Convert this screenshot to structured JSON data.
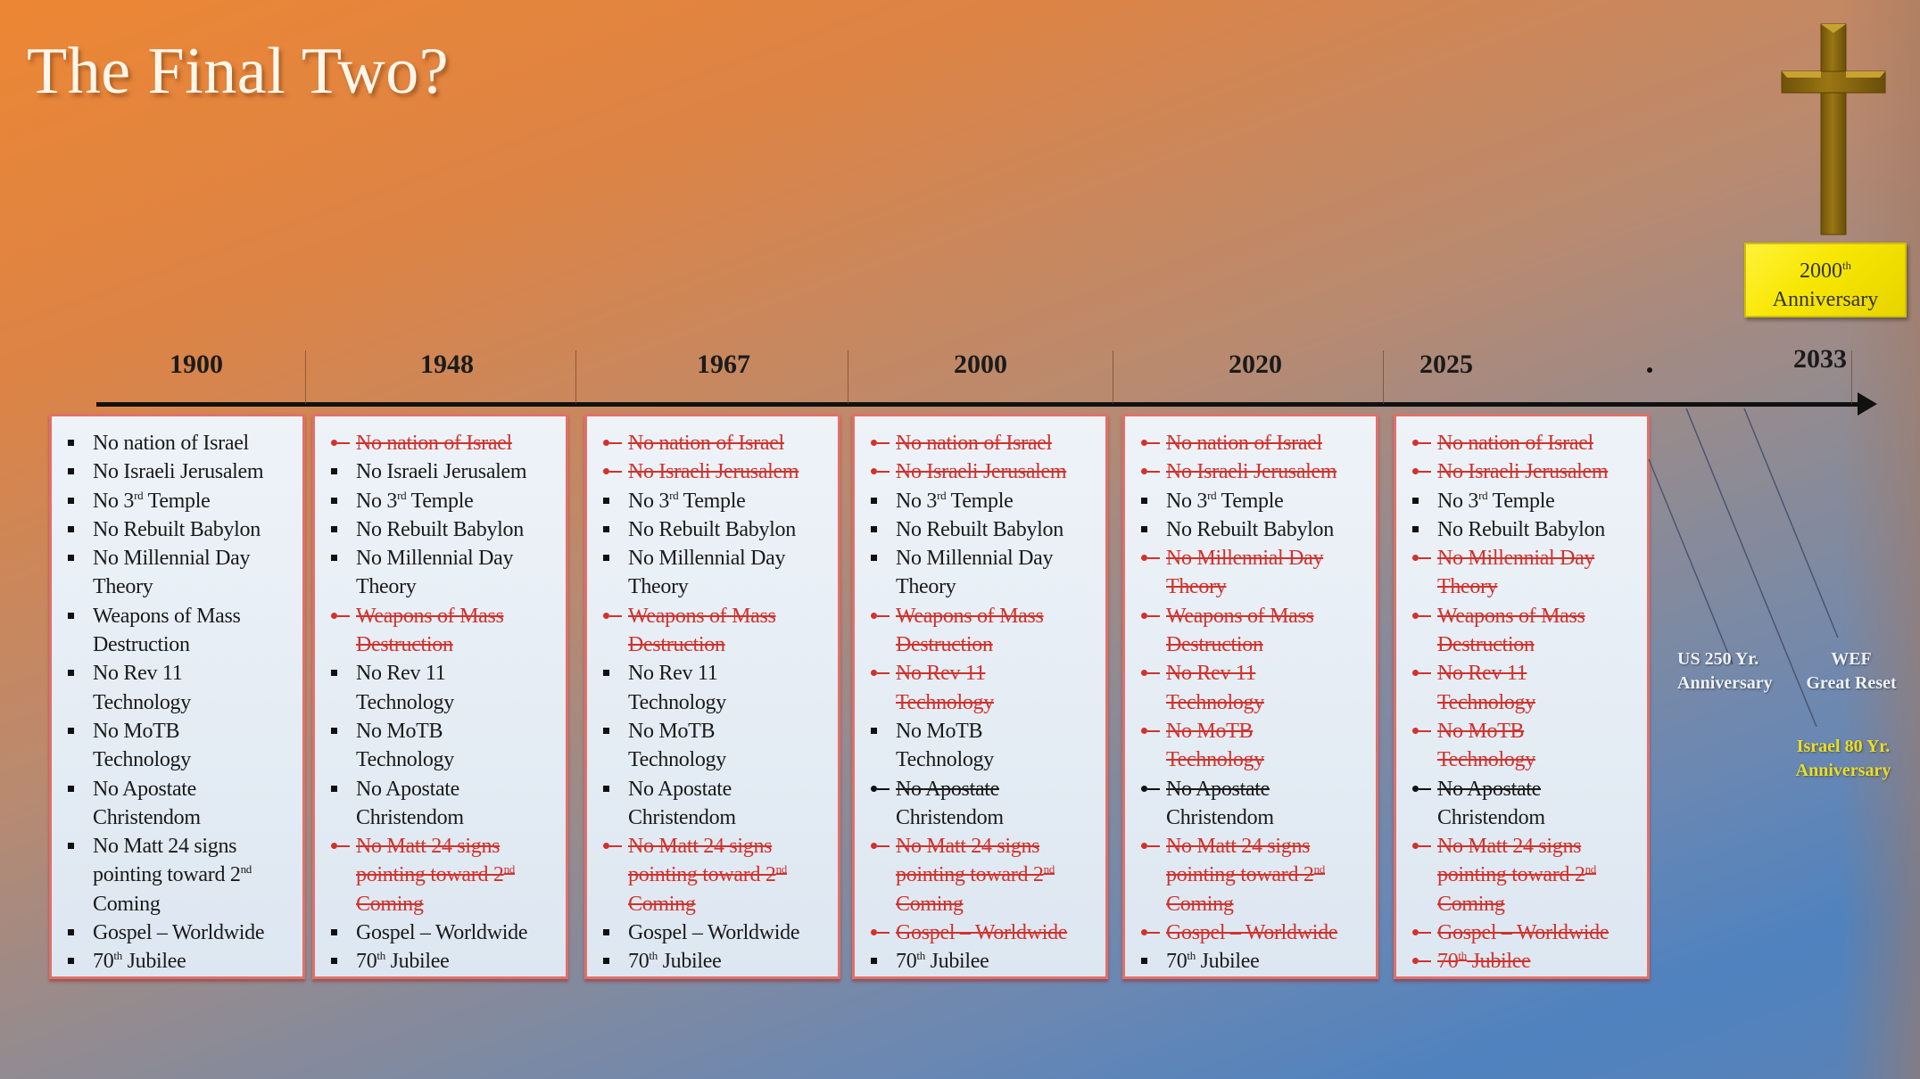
{
  "slide": {
    "title": "The Final Two?",
    "anniversary_badge": {
      "number": "2000",
      "suffix": "th",
      "label": "Anniversary"
    },
    "colors": {
      "struck_red": "#d0322d",
      "box_border": "#e0706a",
      "badge_yellow": "#f7e600",
      "gold_label": "#e9dd2c"
    }
  },
  "timeline": {
    "years": [
      "1900",
      "1948",
      "1967",
      "2000",
      "2020",
      "2025",
      "2033"
    ],
    "marker": "•",
    "events": [
      {
        "label_line1": "US 250 Yr.",
        "label_line2": "Anniversary",
        "style": "white"
      },
      {
        "label_line1": "WEF",
        "label_line2": "Great Reset",
        "style": "white"
      },
      {
        "label_line1": "Israel 80 Yr.",
        "label_line2": "Anniversary",
        "style": "gold"
      }
    ]
  },
  "items": [
    {
      "text": "No nation of Israel"
    },
    {
      "text": "No Israeli Jerusalem"
    },
    {
      "pre": "No 3",
      "sup": "rd",
      "post": " Temple"
    },
    {
      "text": "No Rebuilt Babylon"
    },
    {
      "line1": "No Millennial Day",
      "line2": "Theory"
    },
    {
      "line1": "Weapons of Mass",
      "line2": "Destruction"
    },
    {
      "line1": "No Rev 11",
      "line2": "Technology"
    },
    {
      "line1": "No MoTB",
      "line2": "Technology"
    },
    {
      "line1": "No Apostate",
      "line2": "Christendom"
    },
    {
      "line1": "No Matt 24 signs",
      "line2pre": "pointing toward 2",
      "line2sup": "nd",
      "line3": "Coming"
    },
    {
      "text": "Gospel – Worldwide"
    },
    {
      "pre": "70",
      "sup": "th",
      "post": " Jubilee"
    }
  ],
  "columns": [
    {
      "year": "1900",
      "status": [
        "none",
        "none",
        "none",
        "none",
        "none",
        "none",
        "none",
        "none",
        "none",
        "none",
        "none",
        "none"
      ]
    },
    {
      "year": "1948",
      "status": [
        "red",
        "none",
        "none",
        "none",
        "none",
        "red",
        "none",
        "none",
        "none",
        "red",
        "none",
        "none"
      ]
    },
    {
      "year": "1967",
      "status": [
        "red",
        "red",
        "none",
        "none",
        "none",
        "red",
        "none",
        "none",
        "none",
        "red",
        "none",
        "none"
      ]
    },
    {
      "year": "2000",
      "status": [
        "red",
        "red",
        "none",
        "none",
        "none",
        "red",
        "red",
        "none",
        "black",
        "red",
        "red",
        "none"
      ]
    },
    {
      "year": "2020",
      "status": [
        "red",
        "red",
        "none",
        "none",
        "red",
        "red",
        "red",
        "red",
        "black",
        "red",
        "red",
        "none"
      ]
    },
    {
      "year": "2025",
      "status": [
        "red",
        "red",
        "none",
        "none",
        "red",
        "red",
        "red",
        "red",
        "black",
        "red",
        "red",
        "red"
      ]
    }
  ]
}
